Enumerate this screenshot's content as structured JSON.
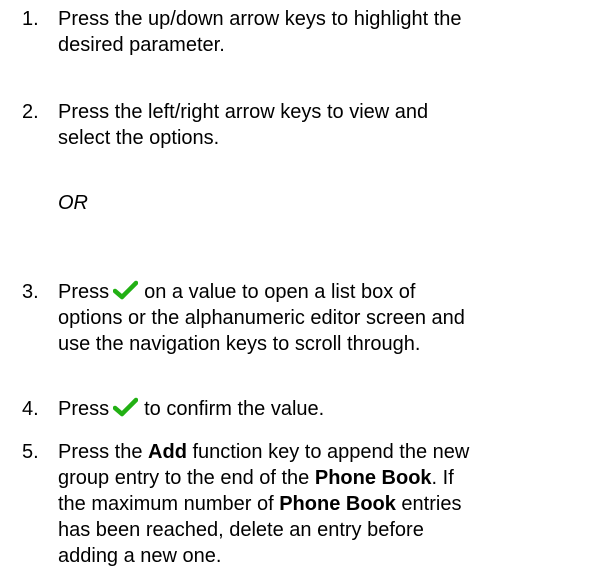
{
  "steps": [
    {
      "number": "1.",
      "lines": [
        "Press the up/down arrow keys to highlight the",
        "desired parameter."
      ]
    },
    {
      "number": "2.",
      "lines": [
        "Press the left/right arrow keys to view and",
        "select the options."
      ]
    },
    {
      "number": "3.",
      "line1_before": "Press",
      "line1_after": "on a value to open a list box of",
      "lines_rest": [
        "options or the alphanumeric editor screen and",
        "use the navigation keys to scroll through."
      ]
    },
    {
      "number": "4.",
      "before": "Press",
      "after": "to confirm the value."
    },
    {
      "number": "5.",
      "l1_a": "Press the ",
      "l1_b": "Add",
      "l1_c": " function key to append the new",
      "l2_a": "group entry to the end of the ",
      "l2_b": "Phone Book",
      "l2_c": ". If",
      "l3_a": "the maximum number of ",
      "l3_b": "Phone Book",
      "l3_c": " entries",
      "l4": "has been reached, delete an entry before",
      "l5": "adding a new one."
    }
  ],
  "or_text": "OR",
  "icons": {
    "confirm": "checkmark-icon",
    "confirm_color": "#22b014"
  }
}
